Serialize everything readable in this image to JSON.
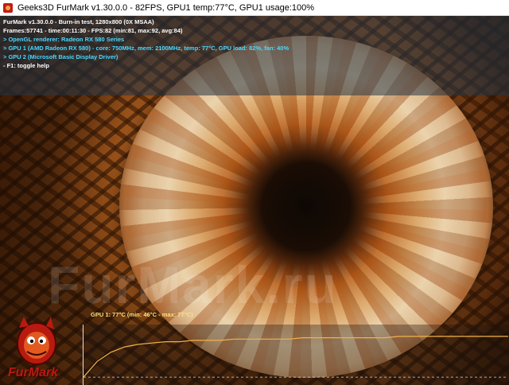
{
  "window": {
    "title": "Geeks3D FurMark v1.30.0.0 - 82FPS, GPU1 temp:77°C, GPU1 usage:100%"
  },
  "info": {
    "lines": [
      {
        "text": "FurMark v1.30.0.0 - Burn-in test, 1280x800 (0X MSAA)",
        "color": "#ffffff"
      },
      {
        "text": "Frames:57741 - time:00:11:30 - FPS:82 (min:81, max:92, avg:84)",
        "color": "#ffffff"
      },
      {
        "text": "> OpenGL renderer: Radeon RX 580 Series",
        "color": "#4ad8ff"
      },
      {
        "text": "> GPU 1 (AMD Radeon RX 580) - core: 750MHz, mem: 2100MHz, temp: 77°C, GPU load: 82%, fan: 40%",
        "color": "#4ad8ff"
      },
      {
        "text": "> GPU 2 (Microsoft Basic Display Driver)",
        "color": "#4ad8ff"
      },
      {
        "text": "- F1: toggle help",
        "color": "#ffffff"
      }
    ]
  },
  "watermark": "FurMark.ru",
  "logo": {
    "text": "FurMark"
  },
  "graph": {
    "label": "GPU 1: 77°C (min: 46°C - max: 77°C)",
    "line_color": "#f2b24a",
    "temps": [
      46,
      58,
      65,
      69,
      71,
      72,
      73,
      73,
      74,
      74,
      74,
      75,
      75,
      75,
      75,
      75,
      76,
      76,
      76,
      76,
      76,
      76,
      76,
      77,
      77,
      77,
      77,
      77,
      77,
      77,
      77,
      77
    ],
    "range": [
      40,
      80
    ],
    "dashed_level": 46
  }
}
